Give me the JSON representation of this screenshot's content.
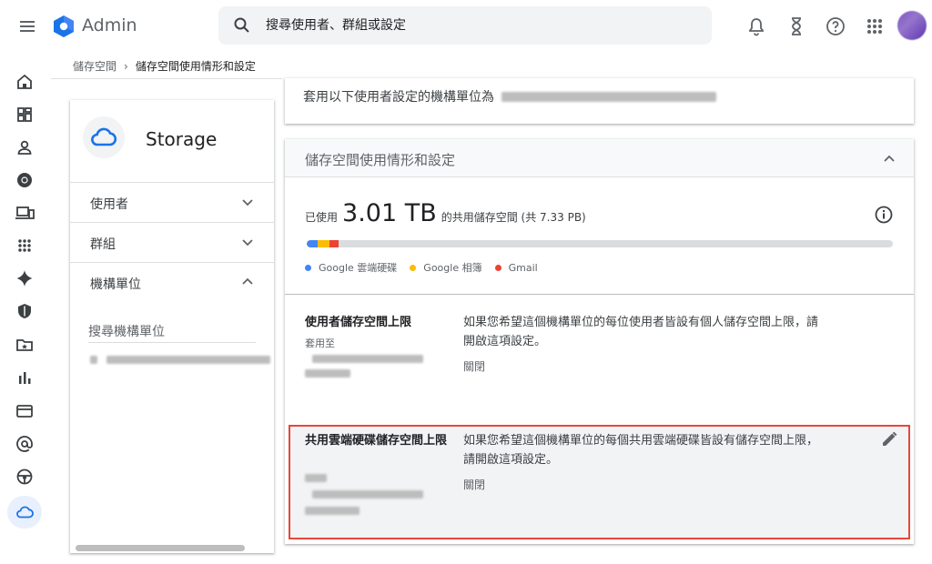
{
  "header": {
    "app_title": "Admin",
    "search_placeholder": "搜尋使用者、群組或設定"
  },
  "breadcrumb": {
    "parent": "儲存空間",
    "separator": "›",
    "current": "儲存空間使用情形和設定"
  },
  "left_panel": {
    "title": "Storage",
    "rows": [
      {
        "label": "使用者"
      },
      {
        "label": "群組"
      },
      {
        "label": "機構單位"
      }
    ],
    "ou_search_placeholder": "搜尋機構單位"
  },
  "top_card": {
    "text": "套用以下使用者設定的機構單位為"
  },
  "main_card": {
    "title": "儲存空間使用情形和設定",
    "usage_prefix": "已使用",
    "usage_value": "3.01 TB",
    "usage_suffix": "的共用儲存空間 (共 7.33 PB)",
    "usage_bar": {
      "segments": [
        {
          "name": "Google 雲端硬碟",
          "color": "#4285f4"
        },
        {
          "name": "Google 相簿",
          "color": "#fbbc04"
        },
        {
          "name": "Gmail",
          "color": "#ea4335"
        }
      ]
    },
    "settings": [
      {
        "name": "使用者儲存空間上限",
        "applied": "套用至",
        "description": "如果您希望這個機構單位的每位使用者皆設有個人儲存空間上限，請開啟這項設定。",
        "state": "關閉"
      },
      {
        "name": "共用雲端硬碟儲存空間上限",
        "description": "如果您希望這個機構單位的每個共用雲端硬碟皆設有儲存空間上限，請開啟這項設定。",
        "state": "關閉"
      }
    ]
  },
  "colors": {
    "accent": "#1a73e8",
    "highlight_border": "#e8463a"
  }
}
